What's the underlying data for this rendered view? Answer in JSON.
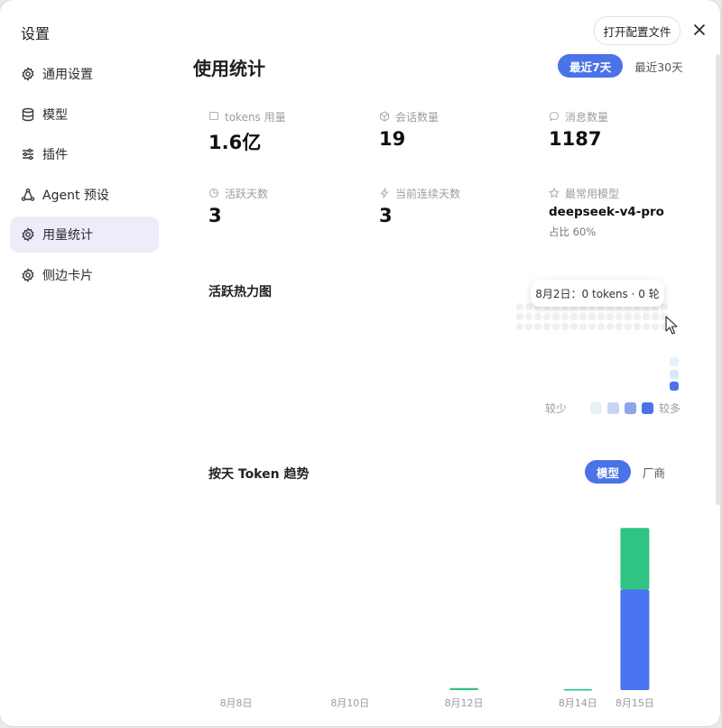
{
  "window": {
    "title": "设置"
  },
  "sidebar": {
    "items": [
      {
        "label": "通用设置",
        "icon": "gear-icon"
      },
      {
        "label": "模型",
        "icon": "database-icon"
      },
      {
        "label": "插件",
        "icon": "sliders-icon"
      },
      {
        "label": "Agent 预设",
        "icon": "agent-icon"
      },
      {
        "label": "用量统计",
        "icon": "gear-icon",
        "active": true
      },
      {
        "label": "侧边卡片",
        "icon": "gear-icon"
      }
    ]
  },
  "header": {
    "open_config_label": "打开配置文件",
    "page_title": "使用统计",
    "range_tabs": [
      {
        "label": "最近7天",
        "active": true
      },
      {
        "label": "最近30天",
        "active": false
      }
    ]
  },
  "stats": {
    "tokens": {
      "label": "tokens 用量",
      "value": "1.6亿"
    },
    "sessions": {
      "label": "会话数量",
      "value": "19"
    },
    "messages": {
      "label": "消息数量",
      "value": "1187"
    },
    "active_days": {
      "label": "活跃天数",
      "value": "3"
    },
    "streak": {
      "label": "当前连续天数",
      "value": "3"
    },
    "top_model": {
      "label": "最常用模型",
      "value": "deepseek-v4-pro",
      "share": "占比 60%"
    }
  },
  "heatmap": {
    "title": "活跃热力图",
    "tooltip": "8月2日：0 tokens · 0 轮",
    "legend_less": "较少",
    "legend_more": "较多",
    "legend_colors": [
      "#e6f1f8",
      "#c6d6f2",
      "#8ca8ea",
      "#4a73e8"
    ]
  },
  "trend": {
    "title": "按天 Token 趋势",
    "toggle": [
      {
        "label": "模型",
        "active": true
      },
      {
        "label": "厂商",
        "active": false
      }
    ]
  },
  "colors": {
    "accent": "#4a73e8",
    "green": "#2fc485",
    "blue": "#4a73f0"
  },
  "chart_data": {
    "type": "bar",
    "stacked": true,
    "categories": [
      "8月8日",
      "8月9日",
      "8月10日",
      "8月11日",
      "8月12日",
      "8月13日",
      "8月14日",
      "8月15日"
    ],
    "tick_labels": [
      "8月8日",
      "8月10日",
      "8月12日",
      "8月14日",
      "8月15日"
    ],
    "series": [
      {
        "color": "#4a73f0",
        "values": [
          0,
          0,
          0,
          0,
          0,
          0,
          0,
          98
        ]
      },
      {
        "color": "#2fc485",
        "values": [
          0,
          0,
          0,
          0,
          2,
          0,
          1,
          60
        ]
      }
    ],
    "ylim": [
      0,
      160
    ],
    "grid": false,
    "legend": "none"
  }
}
